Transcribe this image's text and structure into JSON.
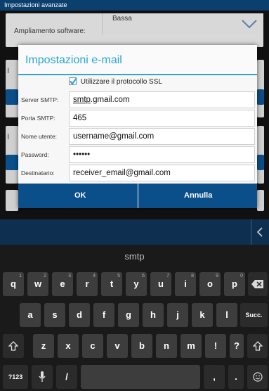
{
  "statusbar": {
    "title": "Impostazioni avanzate"
  },
  "background": {
    "expansion_label": "Ampliamento software:",
    "expansion_value": "Bassa",
    "row_letter": "I"
  },
  "dialog": {
    "title": "Impostazioni e-mail",
    "ssl_label": "Utilizzare il protocollo SSL",
    "ssl_checked": true,
    "fields": [
      {
        "label": "Server SMTP:",
        "value_underlined": "smtp",
        "value_rest": ".gmail.com"
      },
      {
        "label": "Porta SMTP:",
        "value": "465"
      },
      {
        "label": "Nome utente:",
        "value": "username@gmail.com"
      },
      {
        "label": "Password:",
        "value": "••••••"
      },
      {
        "label": "Destinatario:",
        "value": "receiver_email@gmail.com"
      }
    ],
    "ok_label": "OK",
    "cancel_label": "Annulla"
  },
  "keyboard": {
    "suggestion": "smtp",
    "row1": [
      "q",
      "w",
      "e",
      "r",
      "t",
      "y",
      "u",
      "i",
      "o",
      "p"
    ],
    "row1_hints": [
      "1",
      "2",
      "3",
      "4",
      "5",
      "6",
      "7",
      "8",
      "9",
      "0"
    ],
    "row2": [
      "a",
      "s",
      "d",
      "f",
      "g",
      "h",
      "j",
      "k",
      "l"
    ],
    "row2_enter": "Succ.",
    "row3": [
      "z",
      "x",
      "c",
      "v",
      "b",
      "n",
      "m",
      "!",
      "?"
    ],
    "row4_symbols": "?123",
    "row4_slash": "/",
    "row4_comma": ",",
    "row4_period": "."
  },
  "colors": {
    "accent": "#2aa5d6",
    "button": "#0b4f8a",
    "keyboard_bg": "#1a1a1a"
  }
}
